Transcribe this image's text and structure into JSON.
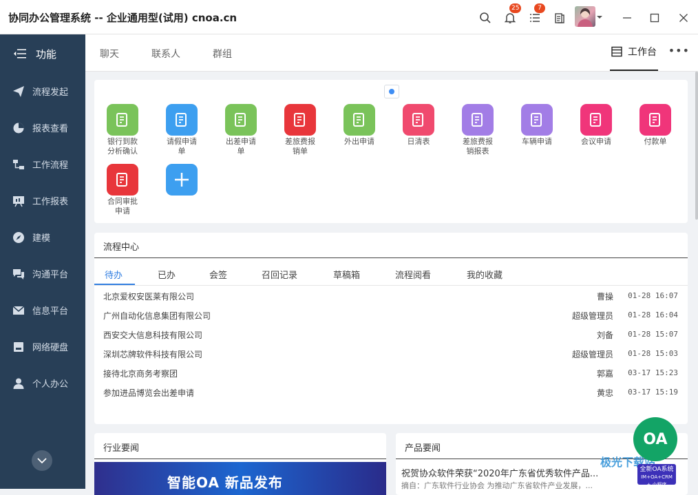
{
  "titlebar": {
    "title": "协同办公管理系统 -- 企业通用型(试用) cnoa.cn",
    "notif_count": "25",
    "task_count": "7"
  },
  "sidebar": {
    "header": "功能",
    "items": [
      {
        "label": "流程发起",
        "icon": "paper-plane-icon"
      },
      {
        "label": "报表查看",
        "icon": "pie-chart-icon"
      },
      {
        "label": "工作流程",
        "icon": "workflow-icon"
      },
      {
        "label": "工作报表",
        "icon": "board-icon"
      },
      {
        "label": "建模",
        "icon": "compass-icon"
      },
      {
        "label": "沟通平台",
        "icon": "chat-icon"
      },
      {
        "label": "信息平台",
        "icon": "mail-icon"
      },
      {
        "label": "网络硬盘",
        "icon": "disk-icon"
      },
      {
        "label": "个人办公",
        "icon": "person-icon"
      }
    ]
  },
  "topnav": {
    "tabs": [
      "聊天",
      "联系人",
      "群组"
    ],
    "workbench": "工作台",
    "more": "•••"
  },
  "apps": [
    {
      "l1": "银行到款",
      "l2": "分析确认",
      "color": "#7ac35a"
    },
    {
      "l1": "请假申请",
      "l2": "单",
      "color": "#3d9ff0"
    },
    {
      "l1": "出差申请",
      "l2": "单",
      "color": "#7ac35a"
    },
    {
      "l1": "差旅费报",
      "l2": "销单",
      "color": "#e8363b"
    },
    {
      "l1": "外出申请",
      "l2": "",
      "color": "#7ac35a"
    },
    {
      "l1": "日清表",
      "l2": "",
      "color": "#f04a6e"
    },
    {
      "l1": "差旅费报",
      "l2": "销报表",
      "color": "#a27de6"
    },
    {
      "l1": "车辆申请",
      "l2": "",
      "color": "#a27de6"
    },
    {
      "l1": "会议申请",
      "l2": "",
      "color": "#f0357a"
    },
    {
      "l1": "付款单",
      "l2": "",
      "color": "#f0357a"
    },
    {
      "l1": "合同审批",
      "l2": "申请",
      "color": "#e8363b"
    },
    {
      "l1": "",
      "l2": "",
      "color": "#3d9ff0"
    }
  ],
  "process": {
    "title": "流程中心",
    "tabs": [
      "待办",
      "已办",
      "会签",
      "召回记录",
      "草稿箱",
      "流程阅看",
      "我的收藏"
    ],
    "rows": [
      {
        "name": "北京爱权安医莱有限公司",
        "user": "曹操",
        "time": "01-28 16:07"
      },
      {
        "name": "广州自动化信息集团有限公司",
        "user": "超级管理员",
        "time": "01-28 16:04"
      },
      {
        "name": "西安交大信息科技有限公司",
        "user": "刘备",
        "time": "01-28 15:07"
      },
      {
        "name": "深圳芯牌软件科技有限公司",
        "user": "超级管理员",
        "time": "01-28 15:03"
      },
      {
        "name": "接待北京商务考察团",
        "user": "郭嘉",
        "time": "03-17 15:23"
      },
      {
        "name": "参加进品博览会出差申请",
        "user": "黄忠",
        "time": "03-17 15:19"
      }
    ]
  },
  "news": {
    "title": "行业要闻",
    "banner": "智能OA 新品发布"
  },
  "product_news": {
    "title": "产品要闻",
    "headline": "祝贺协众软件荣获“2020年广东省优秀软件产品...",
    "summary": "摘自：广东软件行业协会  为推动广东省软件产业发展，..."
  },
  "float": {
    "logo": "OA",
    "badge1": "全新OA系统",
    "badge2": "IM+OA+CRM",
    "badge3": "+ 小程序"
  },
  "watermark": "极光下载站"
}
